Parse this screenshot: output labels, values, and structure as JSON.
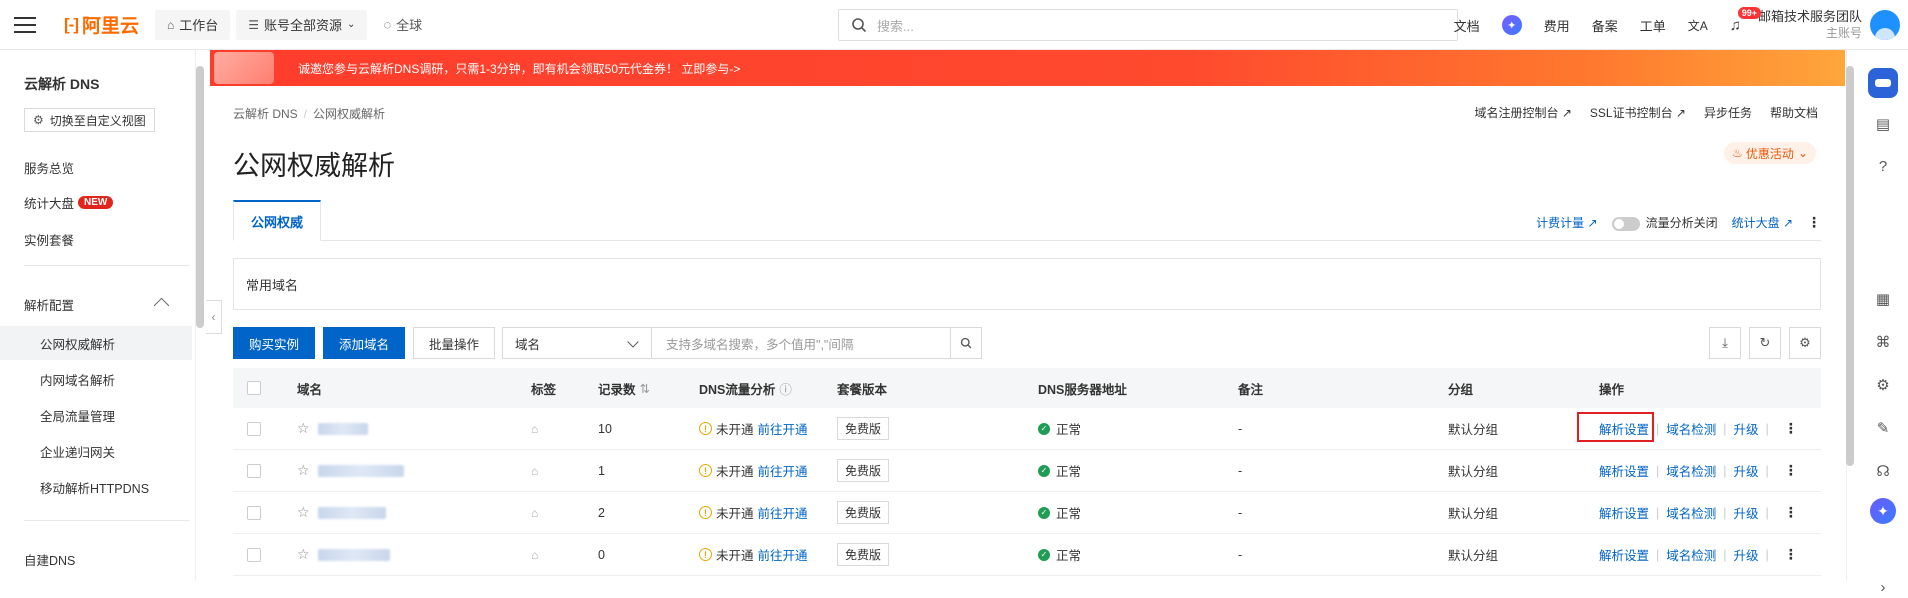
{
  "topbar": {
    "logo_text": "阿里云",
    "workbench": "工作台",
    "resources": "账号全部资源",
    "region": "全球",
    "search_placeholder": "搜索...",
    "links": [
      "文档",
      "费用",
      "备案",
      "工单"
    ],
    "notify_badge": "99+",
    "account_name": "邮箱技术服务团队",
    "account_role": "主账号"
  },
  "sidebar": {
    "title": "云解析 DNS",
    "switch_view": "切换至自定义视图",
    "overview": "服务总览",
    "stats": "统计大盘",
    "stats_badge": "NEW",
    "instances": "实例套餐",
    "group": "解析配置",
    "sub": [
      "公网权威解析",
      "内网域名解析",
      "全局流量管理",
      "企业递归网关",
      "移动解析HTTPDNS"
    ],
    "self_dns": "自建DNS"
  },
  "banner": {
    "text": "诚邀您参与云解析DNS调研，只需1-3分钟，即有机会领取50元代金券！ 立即参与->"
  },
  "breadcrumb": {
    "root": "云解析 DNS",
    "current": "公网权威解析"
  },
  "header_links": [
    "域名注册控制台",
    "SSL证书控制台",
    "异步任务",
    "帮助文档"
  ],
  "page_title": "公网权威解析",
  "promo": "优惠活动",
  "tab_active": "公网权威",
  "tab_tools": {
    "billing": "计费计量",
    "traffic": "流量分析关闭",
    "stats": "统计大盘"
  },
  "common_domains": "常用域名",
  "toolbar": {
    "buy": "购买实例",
    "add": "添加域名",
    "batch": "批量操作",
    "select_value": "域名",
    "search_placeholder": "支持多域名搜索，多个值用\",\"间隔"
  },
  "table": {
    "headers": [
      "域名",
      "标签",
      "记录数",
      "DNS流量分析",
      "套餐版本",
      "DNS服务器地址",
      "备注",
      "分组",
      "操作"
    ],
    "rows": [
      {
        "records": "10",
        "traffic": "未开通",
        "traffic_link": "前往开通",
        "plan": "免费版",
        "dns": "正常",
        "note": "-",
        "group": "默认分组"
      },
      {
        "records": "1",
        "traffic": "未开通",
        "traffic_link": "前往开通",
        "plan": "免费版",
        "dns": "正常",
        "note": "-",
        "group": "默认分组"
      },
      {
        "records": "2",
        "traffic": "未开通",
        "traffic_link": "前往开通",
        "plan": "免费版",
        "dns": "正常",
        "note": "-",
        "group": "默认分组"
      },
      {
        "records": "0",
        "traffic": "未开通",
        "traffic_link": "前往开通",
        "plan": "免费版",
        "dns": "正常",
        "note": "-",
        "group": "默认分组"
      }
    ],
    "ops": [
      "解析设置",
      "域名检测",
      "升级"
    ]
  },
  "colors": {
    "primary": "#0064c8",
    "brand": "#ff6a00",
    "banner": "#ff3c2c",
    "ok": "#1f9d55",
    "warn": "#e6a700",
    "highlight": "#e02020"
  }
}
